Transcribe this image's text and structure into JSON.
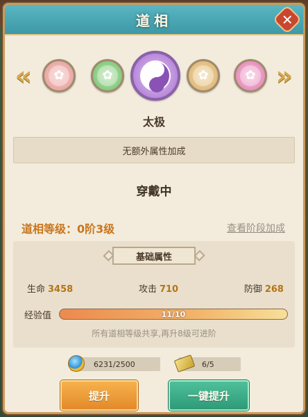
{
  "window": {
    "title": "道相",
    "close_symbol": "✕"
  },
  "carousel": {
    "left_arrow": "«",
    "right_arrow": "»",
    "emblems": [
      {
        "name": "pink-seal",
        "icon": "seal-icon",
        "color": "#e39a98"
      },
      {
        "name": "green-seal",
        "icon": "seal-icon",
        "color": "#6ebf6a"
      },
      {
        "name": "taiji",
        "icon": "taiji-icon",
        "color": "#a66fcf",
        "selected": true
      },
      {
        "name": "gold-seal",
        "icon": "seal-icon",
        "color": "#d9ad66"
      },
      {
        "name": "magenta-seal",
        "icon": "seal-icon",
        "color": "#e07bb0"
      }
    ]
  },
  "selected": {
    "name": "太极",
    "bonus_text": "无额外属性加成",
    "status": "穿戴中"
  },
  "level": {
    "label": "道相等级：",
    "value": "0阶3级",
    "view_link": "查看阶段加成"
  },
  "attributes": {
    "header": "基础属性",
    "stats": [
      {
        "label": "生命",
        "value": "3458"
      },
      {
        "label": "攻击",
        "value": "710"
      },
      {
        "label": "防御",
        "value": "268"
      }
    ],
    "exp": {
      "label": "经验值",
      "text": "11/10",
      "fill": 1.0
    },
    "hint": "所有道相等级共享,再升8级可进阶"
  },
  "costs": {
    "gold": {
      "icon": "gold-orb-icon",
      "text": "6231/2500"
    },
    "ticket": {
      "icon": "ticket-icon",
      "text": "6/5"
    }
  },
  "buttons": {
    "upgrade": "提升",
    "one_click_upgrade": "一键提升"
  }
}
